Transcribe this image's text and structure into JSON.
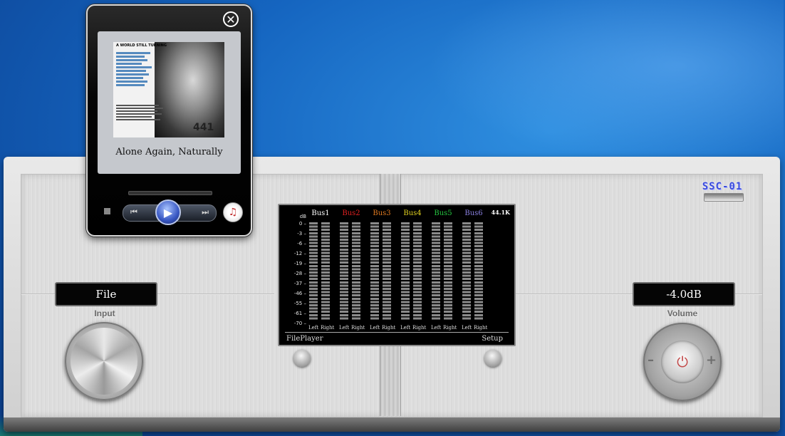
{
  "device": {
    "brand": "SSC-01",
    "input": {
      "display": "File",
      "label": "Input"
    },
    "volume": {
      "display": "-4.0dB",
      "label": "Volume",
      "minus": "–",
      "plus": "+"
    }
  },
  "meter": {
    "sample_rate": "44.1K",
    "db_unit": "dB",
    "db_scale": [
      "0 –",
      "-3 –",
      "-6 –",
      "-12 –",
      "-19 –",
      "-28 –",
      "-37 –",
      "-46 –",
      "-55 –",
      "-61 –",
      "-70 –"
    ],
    "buses": [
      {
        "name": "Bus1",
        "color": "#ffffff"
      },
      {
        "name": "Bus2",
        "color": "#e02020"
      },
      {
        "name": "Bus3",
        "color": "#e07a20"
      },
      {
        "name": "Bus4",
        "color": "#e0d020"
      },
      {
        "name": "Bus5",
        "color": "#25c440"
      },
      {
        "name": "Bus6",
        "color": "#8a80e0"
      }
    ],
    "left_label": "Left",
    "right_label": "Right",
    "footer_left": "FilePlayer",
    "footer_right": "Setup"
  },
  "player": {
    "now_playing": "Alone Again, Naturally",
    "album_cover_text": "A WORLD STILL TURNING",
    "album_cover_number": "441",
    "controls": {
      "prev": "⏮",
      "play": "▶",
      "next": "⏭",
      "close": "✕",
      "library": "♫"
    }
  }
}
